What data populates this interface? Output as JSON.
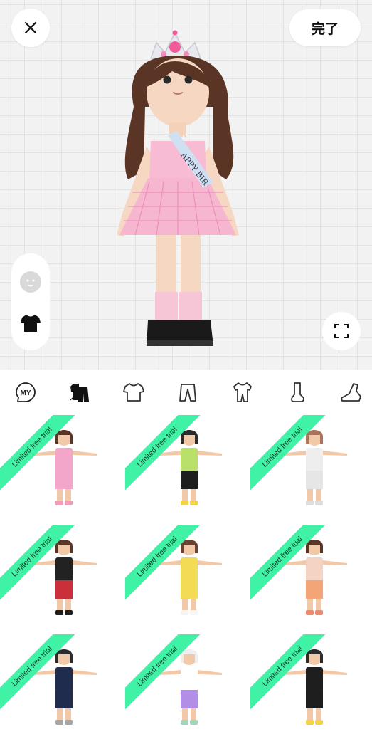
{
  "header": {
    "close_icon": "close-icon",
    "done_label": "完了"
  },
  "side_toolbar": {
    "items": [
      {
        "icon": "face-icon"
      },
      {
        "icon": "tshirt-icon"
      }
    ]
  },
  "fullscreen_icon": "expand-icon",
  "avatar": {
    "sash_text": "APPY BIR"
  },
  "category_tabs": [
    {
      "name": "MY",
      "icon": "my-icon"
    },
    {
      "name": "outfit",
      "icon": "outfit-icon",
      "selected": true
    },
    {
      "name": "tops",
      "icon": "tshirt-icon"
    },
    {
      "name": "bottoms",
      "icon": "pants-icon"
    },
    {
      "name": "onepiece",
      "icon": "onepiece-icon"
    },
    {
      "name": "socks",
      "icon": "sock-icon"
    },
    {
      "name": "shoes",
      "icon": "shoe-icon"
    }
  ],
  "outfits": [
    {
      "badge": "Limited free trial",
      "skin": "#f2c9a8",
      "hair": "#5a3526",
      "top": "#f3a6c9",
      "bottom": "#f3a6c9",
      "shoes": "#f39bb8"
    },
    {
      "badge": "Limited free trial",
      "skin": "#f2c9a8",
      "hair": "#2b2b2b",
      "top": "#b8e06a",
      "bottom": "#1e1e1e",
      "shoes": "#f2d43c"
    },
    {
      "badge": "Limited free trial",
      "skin": "#f2c9a8",
      "hair": "#a8735a",
      "top": "#eeeeee",
      "bottom": "#e6e6e6",
      "shoes": "#dddddd"
    },
    {
      "badge": "Limited free trial",
      "skin": "#f2c9a8",
      "hair": "#5a3526",
      "top": "#222222",
      "bottom": "#c9303a",
      "shoes": "#1e1e1e"
    },
    {
      "badge": "Limited free trial",
      "skin": "#f2c9a8",
      "hair": "#6a4330",
      "top": "#f2dc55",
      "bottom": "#f2dc55",
      "shoes": "#f5f5f5"
    },
    {
      "badge": "Limited free trial",
      "skin": "#f2c9a8",
      "hair": "#5a3526",
      "top": "#f4d3c2",
      "bottom": "#f3a577",
      "shoes": "#f08a6e"
    },
    {
      "badge": "Limited free trial",
      "skin": "#f2c9a8",
      "hair": "#2b2b2b",
      "top": "#1f2c4d",
      "bottom": "#1f2c4d",
      "shoes": "#a6a6a6"
    },
    {
      "badge": "Limited free trial",
      "skin": "#f2c9a8",
      "hair": "#eeeeee",
      "top": "#ffffff",
      "bottom": "#b38ee6",
      "shoes": "#9fd5b8"
    },
    {
      "badge": "Limited free trial",
      "skin": "#f2c9a8",
      "hair": "#2b2b2b",
      "top": "#1e1e1e",
      "bottom": "#1e1e1e",
      "shoes": "#f2d43c"
    }
  ],
  "colors": {
    "ribbon": "#3ff2a6",
    "stage_bg": "#f2f2f2",
    "grid_line": "#e3e3e3"
  }
}
